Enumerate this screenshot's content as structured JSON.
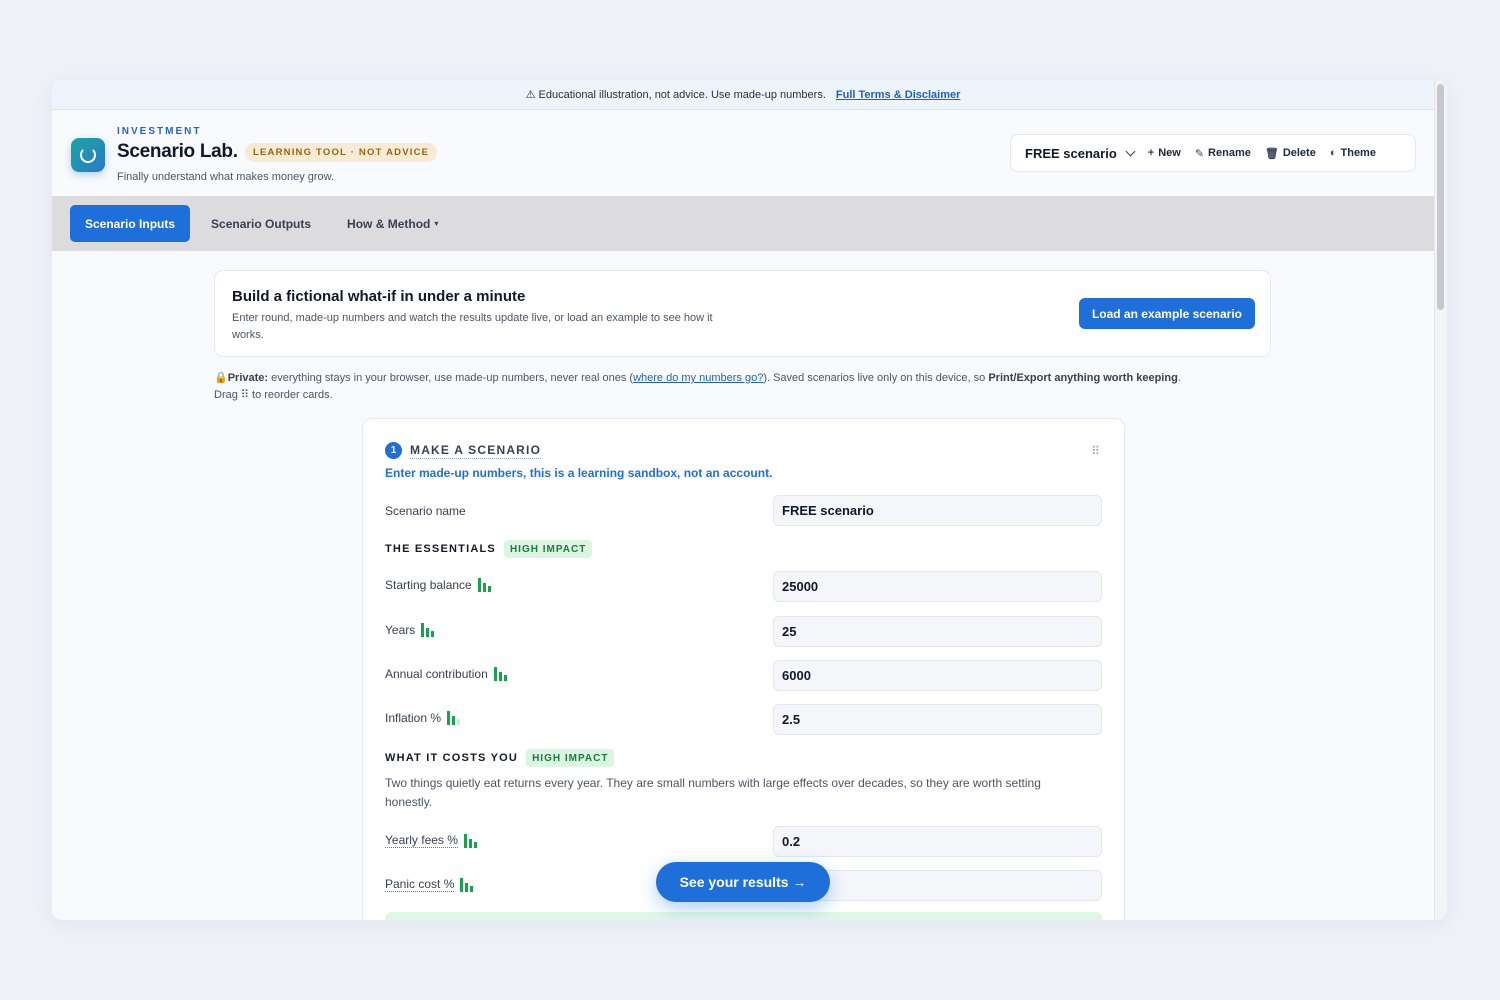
{
  "disclaimer": {
    "text": "⚠ Educational illustration, not advice. Use made-up numbers.",
    "link": "Full Terms & Disclaimer"
  },
  "brand": {
    "eyebrow": "INVESTMENT",
    "title": "Scenario Lab.",
    "badge": "LEARNING TOOL · NOT ADVICE",
    "tagline": "Finally understand what makes money grow."
  },
  "scenario_bar": {
    "selected": "FREE scenario",
    "new_label": "New",
    "rename_label": "Rename",
    "delete_label": "Delete",
    "theme_label": "Theme"
  },
  "tabs": [
    {
      "label": "Scenario Inputs",
      "active": true
    },
    {
      "label": "Scenario Outputs",
      "active": false
    },
    {
      "label": "How & Method",
      "active": false
    }
  ],
  "intro": {
    "title": "Build a fictional what-if in under a minute",
    "text": "Enter round, made-up numbers and watch the results update live, or load an example to see how it works.",
    "button": "Load an example scenario"
  },
  "privacy": {
    "lead": "Private:",
    "text1": " everything stays in your browser, use made-up numbers, never real ones (",
    "link": "where do my numbers go?",
    "text2": "). Saved scenarios live only on this device, so ",
    "bold": "Print/Export anything worth keeping",
    "text3": ".",
    "line2": "Drag ⠿ to reorder cards."
  },
  "card": {
    "step_number": "1",
    "step_title": "MAKE A SCENARIO",
    "subtitle": "Enter made-up numbers, this is a learning sandbox, not an account.",
    "scenario_name_label": "Scenario name",
    "scenario_name_value": "FREE scenario",
    "essentials": {
      "title": "THE ESSENTIALS",
      "badge": "HIGH IMPACT",
      "fields": [
        {
          "label": "Starting balance",
          "value": "25000"
        },
        {
          "label": "Years",
          "value": "25"
        },
        {
          "label": "Annual contribution",
          "value": "6000"
        },
        {
          "label": "Inflation %",
          "value": "2.5"
        }
      ]
    },
    "costs": {
      "title": "WHAT IT COSTS YOU",
      "badge": "HIGH IMPACT",
      "text": "Two things quietly eat returns every year. They are small numbers with large effects over decades, so they are worth setting honestly.",
      "fields": [
        {
          "label": "Yearly fees %",
          "value": "0.2"
        },
        {
          "label": "Panic cost %",
          "value": ""
        }
      ]
    }
  },
  "cta": {
    "label": "See your results →"
  },
  "colors": {
    "accent": "#1e6fd9",
    "impact_green": "#16a34a",
    "badge_amber": "#9a6312",
    "tabs_bg": "#dcdcde"
  },
  "icons": {
    "warning": "warning-icon",
    "logo": "ring-logo-icon",
    "chevron": "chevron-down-icon",
    "new": "plus-icon",
    "rename": "pencil-icon",
    "delete": "trash-icon",
    "theme": "half-circle-icon",
    "drag": "drag-handle-icon",
    "lock": "lock-icon",
    "impact": "impact-bars-icon"
  }
}
